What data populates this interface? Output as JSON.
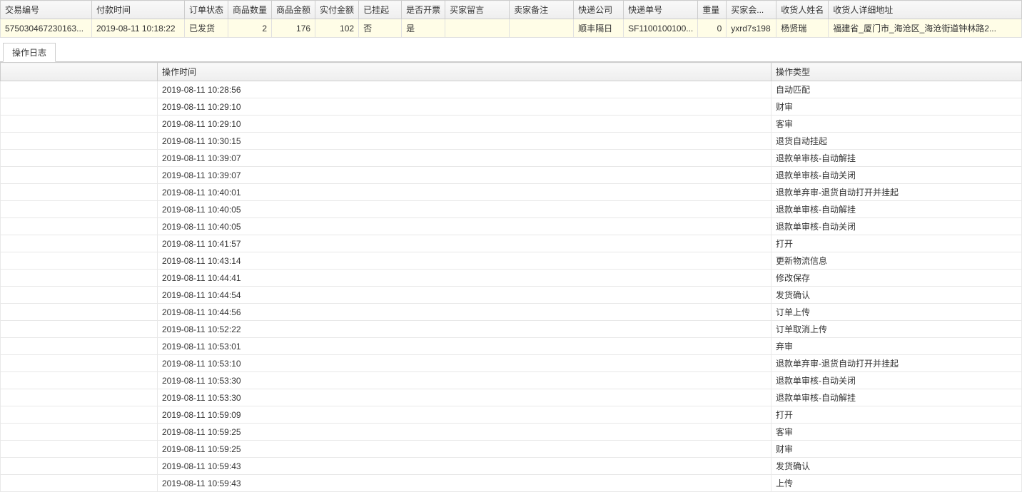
{
  "orderGrid": {
    "headers": [
      "交易编号",
      "付款时间",
      "订单状态",
      "商品数量",
      "商品金额",
      "实付金额",
      "已挂起",
      "是否开票",
      "买家留言",
      "卖家备注",
      "快递公司",
      "快递单号",
      "重量",
      "买家会...",
      "收货人姓名",
      "收货人详细地址"
    ],
    "row": {
      "trade_no": "575030467230163...",
      "pay_time": "2019-08-11 10:18:22",
      "status": "已发货",
      "qty": "2",
      "amount": "176",
      "paid": "102",
      "held": "否",
      "invoice": "是",
      "buyer_msg": "",
      "seller_note": "",
      "courier": "顺丰隔日",
      "tracking": "SF1100100100...",
      "weight": "0",
      "buyer_id": "yxrd7s198",
      "recv_name": "杨贤瑞",
      "recv_addr": "福建省_厦门市_海沧区_海沧街道钟林路2..."
    }
  },
  "tab": {
    "label": "操作日志"
  },
  "logTable": {
    "headers": {
      "time": "操作时间",
      "type": "操作类型"
    },
    "rows": [
      {
        "time": "2019-08-11 10:28:56",
        "type": "自动匹配"
      },
      {
        "time": "2019-08-11 10:29:10",
        "type": "财审"
      },
      {
        "time": "2019-08-11 10:29:10",
        "type": "客审"
      },
      {
        "time": "2019-08-11 10:30:15",
        "type": "退货自动挂起"
      },
      {
        "time": "2019-08-11 10:39:07",
        "type": "退款单审核-自动解挂"
      },
      {
        "time": "2019-08-11 10:39:07",
        "type": "退款单审核-自动关闭"
      },
      {
        "time": "2019-08-11 10:40:01",
        "type": "退款单弃审-退货自动打开并挂起"
      },
      {
        "time": "2019-08-11 10:40:05",
        "type": "退款单审核-自动解挂"
      },
      {
        "time": "2019-08-11 10:40:05",
        "type": "退款单审核-自动关闭"
      },
      {
        "time": "2019-08-11 10:41:57",
        "type": "打开"
      },
      {
        "time": "2019-08-11 10:43:14",
        "type": "更新物流信息"
      },
      {
        "time": "2019-08-11 10:44:41",
        "type": "修改保存"
      },
      {
        "time": "2019-08-11 10:44:54",
        "type": "发货确认"
      },
      {
        "time": "2019-08-11 10:44:56",
        "type": "订单上传"
      },
      {
        "time": "2019-08-11 10:52:22",
        "type": "订单取消上传"
      },
      {
        "time": "2019-08-11 10:53:01",
        "type": "弃审"
      },
      {
        "time": "2019-08-11 10:53:10",
        "type": "退款单弃审-退货自动打开并挂起"
      },
      {
        "time": "2019-08-11 10:53:30",
        "type": "退款单审核-自动关闭"
      },
      {
        "time": "2019-08-11 10:53:30",
        "type": "退款单审核-自动解挂"
      },
      {
        "time": "2019-08-11 10:59:09",
        "type": "打开"
      },
      {
        "time": "2019-08-11 10:59:25",
        "type": "客审"
      },
      {
        "time": "2019-08-11 10:59:25",
        "type": "财审"
      },
      {
        "time": "2019-08-11 10:59:43",
        "type": "发货确认"
      },
      {
        "time": "2019-08-11 10:59:43",
        "type": "上传"
      }
    ]
  }
}
